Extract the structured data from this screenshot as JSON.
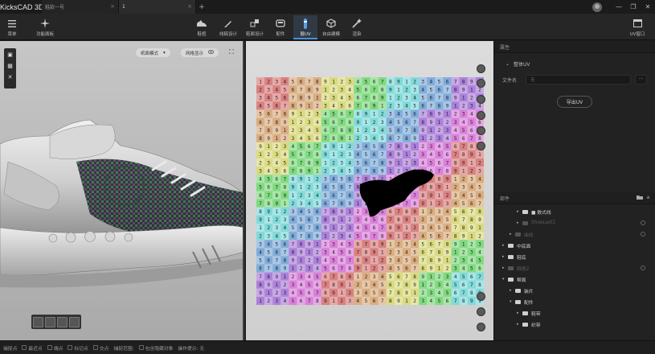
{
  "app": {
    "title": "KicksCAD 3D"
  },
  "tabs": [
    {
      "label": "鞋款一号",
      "close": "×"
    },
    {
      "label": "1",
      "close": "×"
    }
  ],
  "tab_add": "+",
  "window_controls": {
    "minimize": "—",
    "restore": "❐",
    "close": "✕"
  },
  "toolbar": {
    "menu": {
      "label": "菜单"
    },
    "feature_panel": {
      "label": "功能面板"
    },
    "tools": [
      {
        "label": "鞋楦",
        "icon": "shoe-last-icon",
        "active": false
      },
      {
        "label": "线稿设计",
        "icon": "pen-icon",
        "active": false
      },
      {
        "label": "鞋面设计",
        "icon": "upper-design-icon",
        "active": false
      },
      {
        "label": "配件",
        "icon": "accessory-icon",
        "active": false
      },
      {
        "label": "展UV",
        "icon": "uv-icon",
        "active": true
      },
      {
        "label": "自由建模",
        "icon": "cube-icon",
        "active": false
      },
      {
        "label": "渲染",
        "icon": "wand-icon",
        "active": false
      }
    ],
    "uv_window": {
      "label": "UV窗口"
    }
  },
  "left_viewport": {
    "mode_label": "纸面模式",
    "mode_arrow": "▾",
    "grid_label": "网格显示",
    "expand_icon": "⛶"
  },
  "right_panel": {
    "properties_title": "属性",
    "uv_section": "整体UV",
    "file_label": "文件名",
    "file_value": "无",
    "more_label": "···",
    "export_label": "导出UV",
    "parts_title": "部件",
    "tree": [
      {
        "label": "■ 数式线",
        "indent": 2,
        "dim": false,
        "eye": false
      },
      {
        "label": "ShoeLast1",
        "indent": 2,
        "dim": true,
        "eye": true
      },
      {
        "label": "曲线",
        "indent": 1,
        "dim": true,
        "eye": true
      },
      {
        "label": "中底面",
        "indent": 0,
        "dim": false,
        "eye": false
      },
      {
        "label": "鞋底",
        "indent": 0,
        "dim": false,
        "eye": false
      },
      {
        "label": "鞋楦2",
        "indent": 0,
        "dim": true,
        "eye": true
      },
      {
        "label": "帮面",
        "indent": 0,
        "dim": false,
        "eye": false,
        "open": true
      },
      {
        "label": "装片",
        "indent": 1,
        "dim": false,
        "eye": false
      },
      {
        "label": "配件",
        "indent": 1,
        "dim": false,
        "eye": false,
        "open": true
      },
      {
        "label": "鞋带",
        "indent": 2,
        "dim": false,
        "eye": false
      },
      {
        "label": "织带",
        "indent": 2,
        "dim": false,
        "eye": false
      }
    ]
  },
  "statusbar": {
    "items": [
      {
        "label": "捕捉点",
        "checkbox": false
      },
      {
        "label": "最近点",
        "checkbox": true
      },
      {
        "label": "端点",
        "checkbox": true
      },
      {
        "label": "标记点",
        "checkbox": true
      },
      {
        "label": "交点",
        "checkbox": true
      },
      {
        "label": "捕捉范围:",
        "checkbox": false
      },
      {
        "label": "包含隐藏对象",
        "checkbox": true
      },
      {
        "label": "操作提示: 无",
        "checkbox": false
      }
    ]
  },
  "colors": {
    "active_tab": "#4a90d9",
    "bg_dark": "#1e1e1e",
    "panel": "#222222"
  }
}
